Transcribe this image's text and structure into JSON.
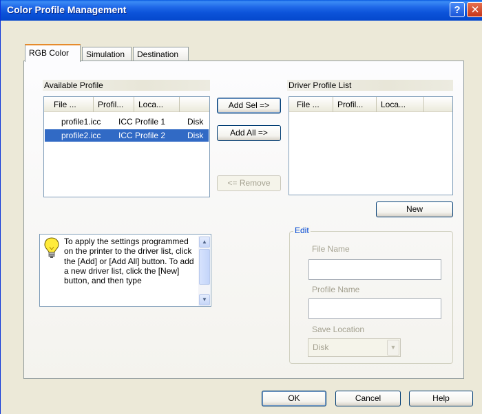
{
  "window": {
    "title": "Color Profile Management",
    "help_glyph": "?",
    "close_glyph": "✕"
  },
  "tabs": [
    {
      "label": "RGB Color",
      "active": true
    },
    {
      "label": "Simulation",
      "active": false
    },
    {
      "label": "Destination",
      "active": false
    }
  ],
  "available_profile": {
    "label": "Available Profile",
    "columns": [
      "File ...",
      "Profil...",
      "Loca..."
    ],
    "rows": [
      {
        "file": "profile1.icc",
        "profile": "ICC Profile 1",
        "location": "Disk",
        "selected": false
      },
      {
        "file": "profile2.icc",
        "profile": "ICC Profile 2",
        "location": "Disk",
        "selected": true
      }
    ]
  },
  "driver_profile_list": {
    "label": "Driver Profile List",
    "columns": [
      "File ...",
      "Profil...",
      "Loca..."
    ]
  },
  "buttons": {
    "add_sel": "Add Sel =>",
    "add_all": "Add All =>",
    "remove": "<= Remove",
    "new": "New",
    "ok": "OK",
    "cancel": "Cancel",
    "help": "Help"
  },
  "info": {
    "text": "To apply the settings programmed on the printer to the driver list, click the [Add] or [Add All] button. To add a new driver list, click the [New] button, and then type",
    "scroll_up": "▲",
    "scroll_down": "▼"
  },
  "edit": {
    "legend": "Edit",
    "file_name_label": "File Name",
    "file_name_value": "",
    "profile_name_label": "Profile Name",
    "profile_name_value": "",
    "save_location_label": "Save Location",
    "save_location_value": "Disk",
    "combo_arrow": "▼"
  }
}
